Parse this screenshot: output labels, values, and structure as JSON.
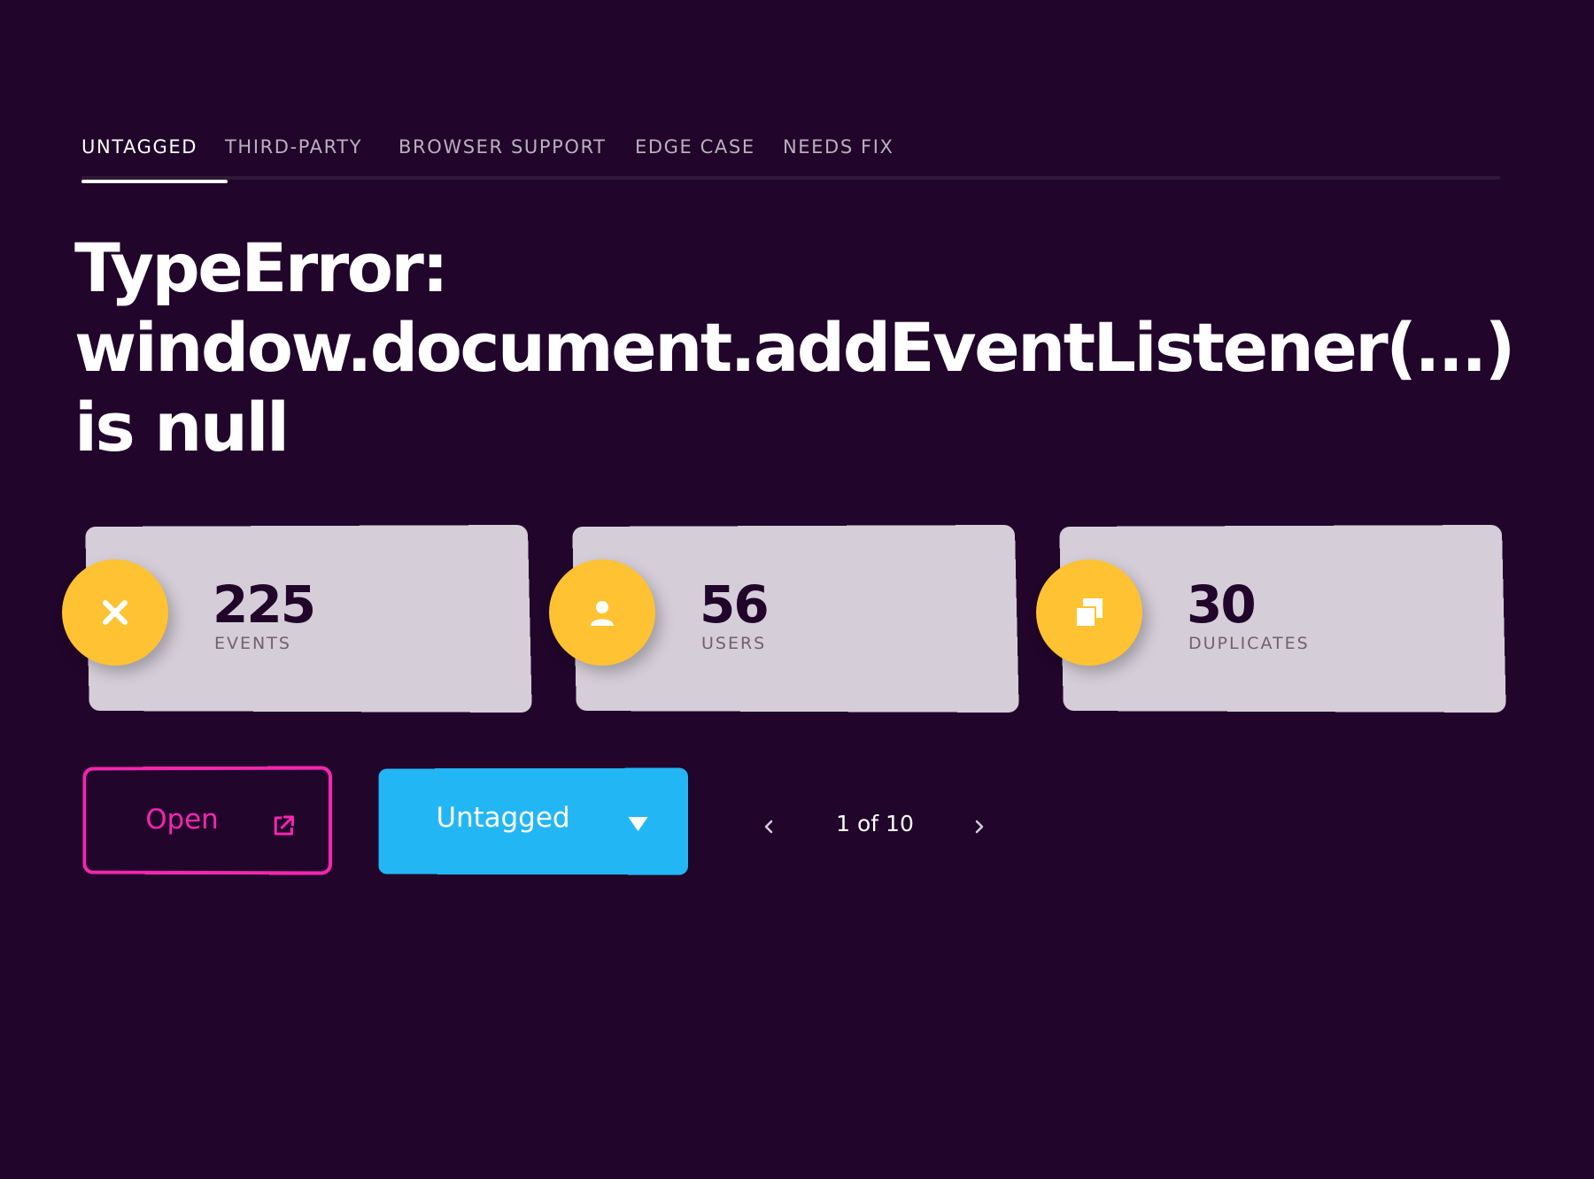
{
  "tabs": [
    {
      "label": "UNTAGGED",
      "active": true
    },
    {
      "label": "THIRD-PARTY",
      "active": false
    },
    {
      "label": "BROWSER SUPPORT",
      "active": false
    },
    {
      "label": "EDGE CASE",
      "active": false
    },
    {
      "label": "NEEDS FIX",
      "active": false
    }
  ],
  "error": {
    "title_lines": [
      "TypeError:",
      "window.document.addEventListener(...)",
      "is null"
    ]
  },
  "stats": [
    {
      "value": "225",
      "label": "EVENTS",
      "icon": "close-icon"
    },
    {
      "value": "56",
      "label": "USERS",
      "icon": "user-icon"
    },
    {
      "value": "30",
      "label": "DUPLICATES",
      "icon": "duplicate-icon"
    }
  ],
  "actions": {
    "open_label": "Open",
    "open_icon": "external-link-icon",
    "tag_select_value": "Untagged"
  },
  "pagination": {
    "text": "1 of 10"
  },
  "colors": {
    "background": "#21052b",
    "accent_yellow": "#fec233",
    "accent_pink": "#f526b0",
    "accent_blue": "#23b6f5",
    "card": "#d5ced8"
  }
}
